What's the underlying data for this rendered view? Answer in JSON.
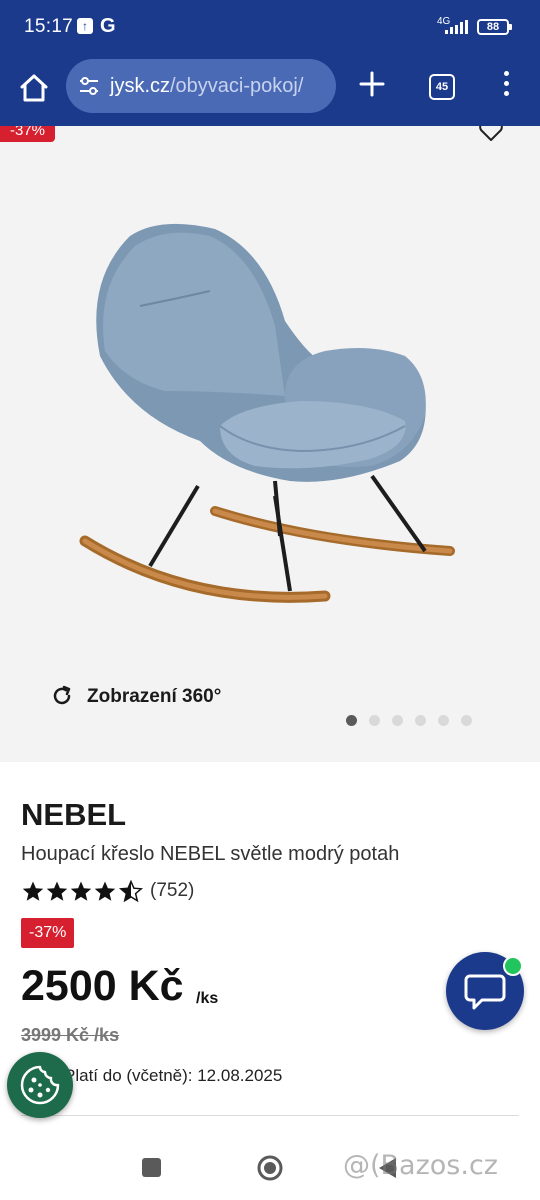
{
  "status_bar": {
    "time": "15:17",
    "g_label": "G",
    "network": "4G",
    "battery": "88"
  },
  "browser": {
    "url_domain": "jysk.cz",
    "url_path": "/obyvaci-pokoj/",
    "tab_count": "45"
  },
  "gallery": {
    "badge": "-37%",
    "view360_label": "Zobrazení 360°",
    "dots_count": 6,
    "active_dot": 0
  },
  "product": {
    "brand": "NEBEL",
    "description": "Houpací křeslo NEBEL světle modrý potah",
    "rating": 4.5,
    "reviews": "(752)",
    "discount": "-37%",
    "price": "2500 Kč",
    "unit": "/ks",
    "old_price": "3999 Kč /ks",
    "validity": "Platí do (včetně): 12.08.2025"
  },
  "watermark": "@(Bazos.cz",
  "colors": {
    "brand_blue": "#1b3a8c",
    "discount_red": "#d6202f",
    "cookie_green": "#1d6b4a",
    "online_green": "#21c55d"
  }
}
